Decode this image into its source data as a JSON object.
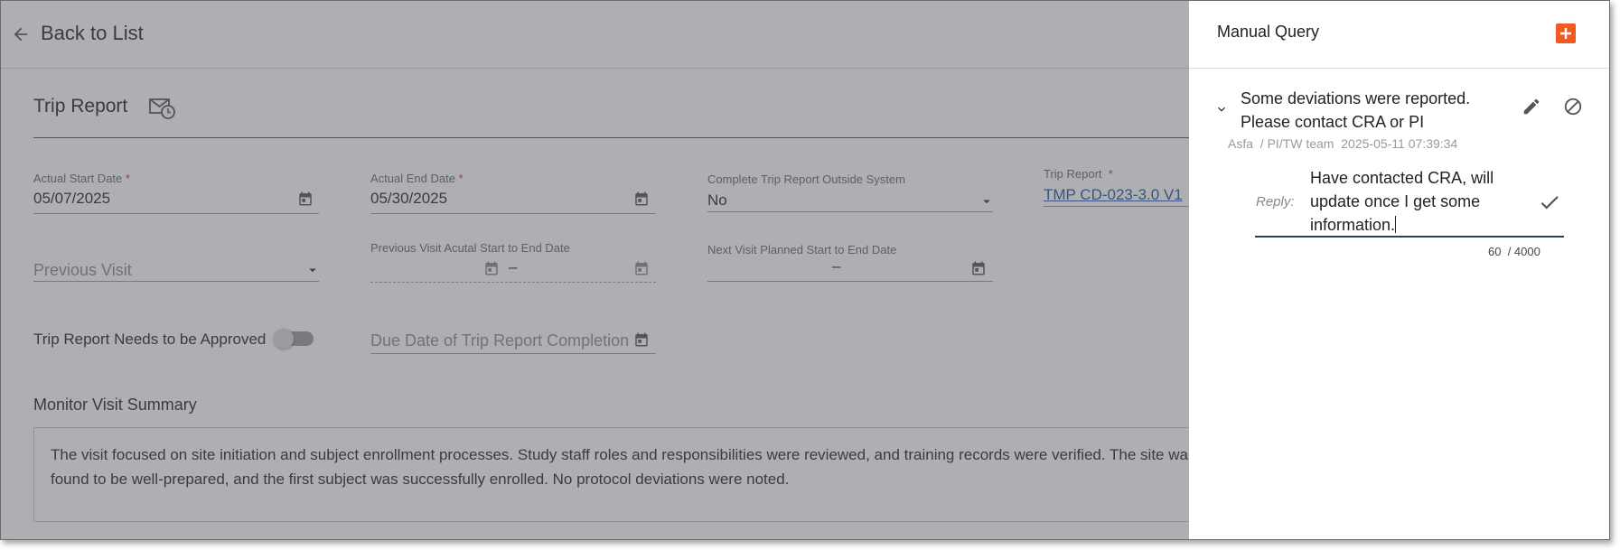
{
  "header": {
    "back_label": "Back to List"
  },
  "form": {
    "title": "Trip Report",
    "actual_start": {
      "label": "Actual Start Date",
      "required_mark": "*",
      "value": "05/07/2025"
    },
    "actual_end": {
      "label": "Actual End Date",
      "required_mark": "*",
      "value": "05/30/2025"
    },
    "outside_system": {
      "label": "Complete Trip Report Outside System",
      "value": "No"
    },
    "trip_report": {
      "label": "Trip Report",
      "required_mark": "*",
      "value": "TMP CD-023-3.0 V1"
    },
    "previous_visit": {
      "placeholder": "Previous Visit"
    },
    "prev_visit_range": {
      "label": "Previous Visit Acutal Start to End Date",
      "separator": "–"
    },
    "next_visit_range": {
      "label": "Next Visit Planned Start to End Date",
      "separator": "–"
    },
    "needs_approval": {
      "label": "Trip Report Needs to be Approved",
      "on": false
    },
    "due_date": {
      "placeholder": "Due Date of Trip Report Completion"
    },
    "summary": {
      "label": "Monitor Visit Summary",
      "text": "The visit focused on site initiation and subject enrollment processes. Study staff roles and responsibilities were reviewed, and training records were verified. The site was found to be well-prepared, and the first subject was successfully enrolled. No protocol deviations were noted."
    }
  },
  "panel": {
    "title": "Manual Query",
    "query": {
      "text": "Some deviations were reported. Please contact CRA or PI",
      "author": "Asfa",
      "team": "/ PI/TW team",
      "timestamp": "2025-05-11 07:39:34"
    },
    "reply": {
      "label": "Reply:",
      "text": "Have contacted CRA, will update once I get some information.",
      "count": "60",
      "max": "/ 4000"
    }
  },
  "colors": {
    "accent_orange": "#f15a22",
    "overlay": "#55586080",
    "link": "#1f4f9a"
  },
  "icons": [
    "arrow-left-icon",
    "mail-clock-icon",
    "calendar-icon",
    "caret-down-icon",
    "plus-icon",
    "chevron-down-icon",
    "pencil-icon",
    "cancel-icon",
    "check-icon"
  ]
}
